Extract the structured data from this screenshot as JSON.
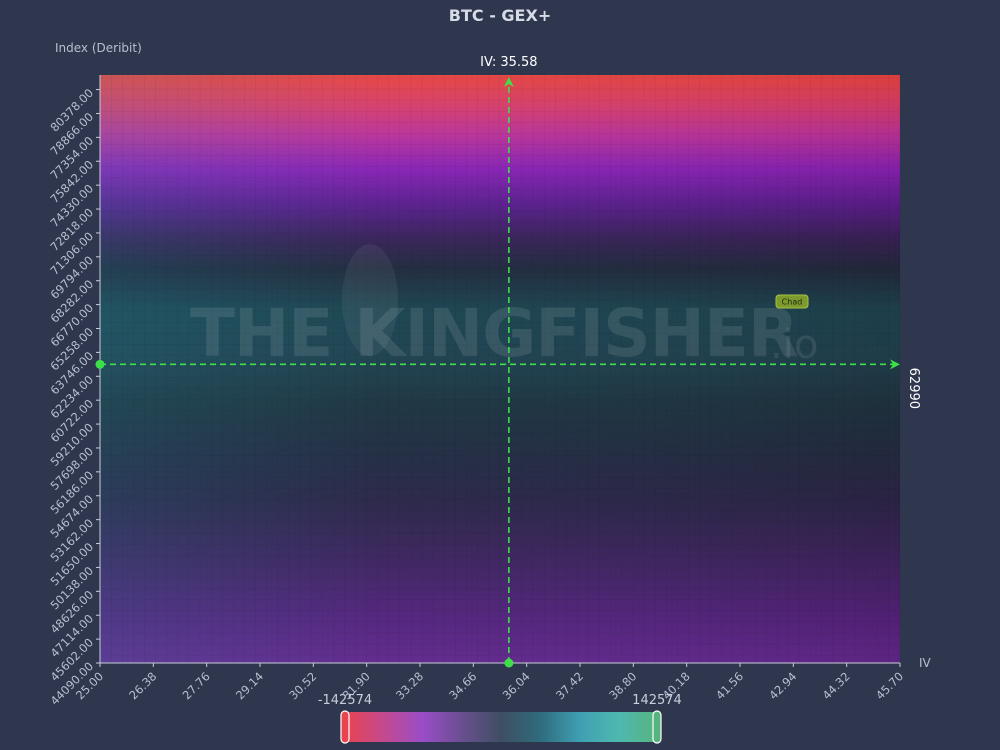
{
  "chart_data": {
    "type": "heatmap",
    "title": "BTC - GEX+",
    "ylabel": "Index (Deribit)",
    "xlabel": "IV",
    "x_ticks": [
      "25.00",
      "26.38",
      "27.76",
      "29.14",
      "30.52",
      "31.90",
      "33.28",
      "34.66",
      "36.04",
      "37.42",
      "38.80",
      "40.18",
      "41.56",
      "42.94",
      "44.32",
      "45.70"
    ],
    "y_ticks": [
      "44090.00",
      "45602.00",
      "47114.00",
      "48626.00",
      "50138.00",
      "51650.00",
      "53162.00",
      "54674.00",
      "56186.00",
      "57698.00",
      "59210.00",
      "60722.00",
      "62234.00",
      "63746.00",
      "65258.00",
      "66770.00",
      "68282.00",
      "69794.00",
      "71306.00",
      "72818.00",
      "74330.00",
      "75842.00",
      "77354.00",
      "78866.00",
      "80378.00"
    ],
    "xlim": [
      25.0,
      45.7
    ],
    "ylim": [
      44090,
      81300
    ],
    "crosshair": {
      "iv_label": "IV: 35.58",
      "iv_value": 35.58,
      "price_label": "62990",
      "price_value": 62990
    },
    "colorbar": {
      "min_label": "-142574",
      "max_label": "142574",
      "min": -142574,
      "max": 142574,
      "stops": [
        "#e8434f",
        "#c44a8d",
        "#9a4dc8",
        "#6a4f90",
        "#3f4e63",
        "#2f6b7d",
        "#3f9fb2",
        "#4fb8b0",
        "#56b57e"
      ]
    },
    "watermark": {
      "text": "THE KINGFISHER",
      "suffix": ".io"
    },
    "badge": "Chad",
    "colors": {
      "background": "#2f374f",
      "crosshair": "#3ee04a",
      "top_band": "#ef4545",
      "low_band": "#6a2a9a"
    }
  }
}
